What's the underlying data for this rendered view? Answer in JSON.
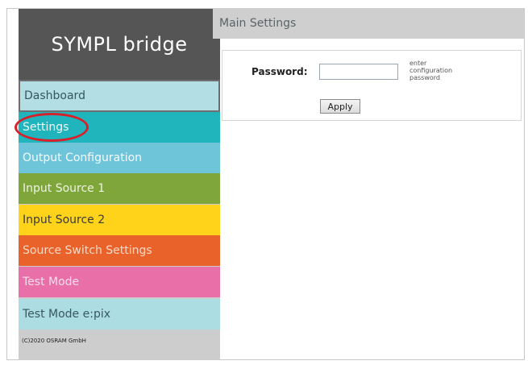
{
  "app": {
    "title": "SYMPL bridge"
  },
  "sidebar": {
    "items": [
      {
        "label": "Dashboard"
      },
      {
        "label": "Settings"
      },
      {
        "label": "Output Configuration"
      },
      {
        "label": "Input Source 1"
      },
      {
        "label": "Input Source 2"
      },
      {
        "label": "Source Switch Settings"
      },
      {
        "label": "Test Mode"
      },
      {
        "label": "Test Mode e:pix"
      }
    ],
    "copyright": "(C)2020 OSRAM GmbH"
  },
  "main": {
    "header": "Main Settings",
    "password_label": "Password:",
    "password_value": "",
    "password_hint": "enter\nconfiguration\npassword",
    "apply_label": "Apply"
  },
  "colors": {
    "logo_bg": "#555555",
    "settings_bg": "#20b5bd",
    "highlight_ring": "#d7202a"
  }
}
